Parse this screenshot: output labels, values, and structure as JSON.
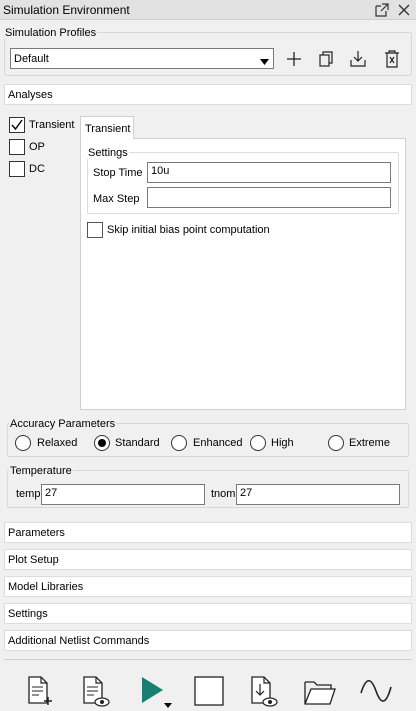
{
  "window": {
    "title": "Simulation Environment"
  },
  "profiles": {
    "legend": "Simulation Profiles",
    "selected": "Default"
  },
  "analyses": {
    "header": "Analyses",
    "items": [
      {
        "label": "Transient",
        "checked": true
      },
      {
        "label": "OP",
        "checked": false
      },
      {
        "label": "DC",
        "checked": false
      }
    ],
    "tab": "Transient",
    "settings": {
      "legend": "Settings",
      "stop_time_label": "Stop Time",
      "stop_time_value": "10u",
      "max_step_label": "Max Step",
      "max_step_value": ""
    },
    "skip_bias_label": "Skip initial bias point computation"
  },
  "accuracy": {
    "legend": "Accuracy Parameters",
    "options": [
      "Relaxed",
      "Standard",
      "Enhanced",
      "High",
      "Extreme"
    ],
    "selected": "Standard"
  },
  "temperature": {
    "legend": "Temperature",
    "temp_label": "temp",
    "temp_value": "27",
    "tnom_label": "tnom",
    "tnom_value": "27"
  },
  "sections": [
    "Parameters",
    "Plot Setup",
    "Model Libraries",
    "Settings",
    "Additional Netlist Commands"
  ],
  "toolbar_icons": [
    "new-netlist-icon",
    "view-netlist-icon",
    "run-icon",
    "stop-icon",
    "import-view-icon",
    "open-folder-icon",
    "waveform-icon"
  ],
  "colors": {
    "run": "#1a7f73",
    "background": "#f0f0f0"
  }
}
